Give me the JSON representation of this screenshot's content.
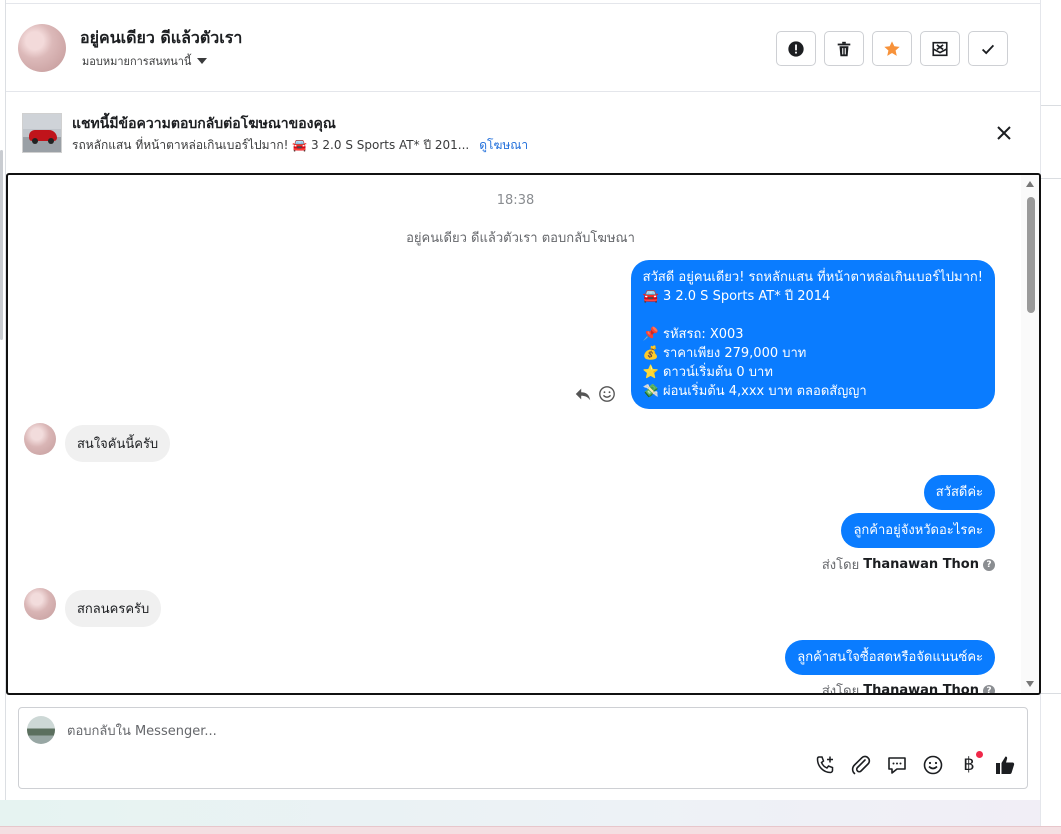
{
  "header": {
    "contact_name": "อยู่คนเดียว ดีแล้วตัวเรา",
    "assign_label": "มอบหมายการสนทนานี้",
    "actions": [
      {
        "name": "spam",
        "icon": "exclamation-circle-icon"
      },
      {
        "name": "delete",
        "icon": "trash-icon"
      },
      {
        "name": "star",
        "icon": "star-icon",
        "color": "#f7923a"
      },
      {
        "name": "mark-unread",
        "icon": "envelope-x-icon"
      },
      {
        "name": "done",
        "icon": "check-icon"
      }
    ]
  },
  "banner": {
    "title": "แชทนี้มีข้อความตอบกลับต่อโฆษณาของคุณ",
    "subtitle": "รถหลักแสน ที่หน้าตาหล่อเกินเบอร์ไปมาก! 🚘 3 2.0 S Sports AT* ปี 201...",
    "link": "ดูโฆษณา"
  },
  "chat": {
    "time": "18:38",
    "replied_notice": "อยู่คนเดียว ดีแล้วตัวเรา ตอบกลับโฆษณา",
    "ad_message_lines": [
      "สวัสดี อยู่คนเดียว! รถหลักแสน ที่หน้าตาหล่อเกินเบอร์ไปมาก!",
      "🚘 3 2.0 S Sports AT* ปี 2014",
      "",
      "📌 รหัสรถ: X003",
      "💰 ราคาเพียง 279,000 บาท",
      "⭐ ดาวน์เริ่มต้น 0 บาท",
      "💸 ผ่อนเริ่มต้น 4,xxx บาท ตลอดสัญญา"
    ],
    "incoming_1": "สนใจคันนี้ครับ",
    "outgoing_1": "สวัสดีค่ะ",
    "outgoing_2": "ลูกค้าอยู่จังหวัดอะไรคะ",
    "sent_by_prefix": "ส่งโดย",
    "agent_name": "Thanawan Thon",
    "incoming_2": "สกลนครครับ",
    "outgoing_3": "ลูกค้าสนใจซื้อสดหรือจัดแนนซ์คะ",
    "help_glyph": "?"
  },
  "composer": {
    "placeholder": "ตอบกลับใน Messenger...",
    "tools": [
      "phone-plus-icon",
      "paperclip-icon",
      "chat-bubble-icon",
      "smiley-icon",
      "baht-icon",
      "thumbs-up-icon"
    ],
    "baht_glyph": "฿",
    "accent": "#0a7cff"
  }
}
